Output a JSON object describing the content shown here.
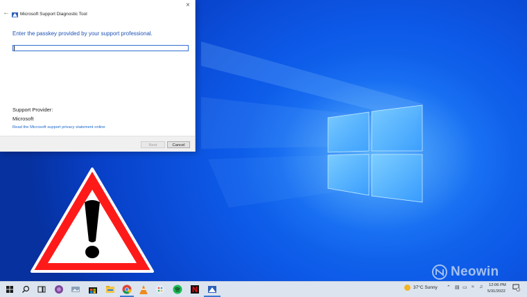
{
  "dialog": {
    "title": "Microsoft Support Diagnostic Tool",
    "prompt": "Enter the passkey provided by your support professional.",
    "passkey_value": "",
    "provider_label": "Support Provider:",
    "provider_name": "Microsoft",
    "privacy_link": "Read the Microsoft support privacy statement online",
    "next_label": "Next",
    "cancel_label": "Cancel"
  },
  "watermark": {
    "text": "Neowin"
  },
  "taskbar": {
    "icons": [
      "windows-start-icon",
      "search-icon",
      "task-view-icon",
      "tor-browser-icon",
      "photos-icon",
      "microsoft-store-icon",
      "file-explorer-icon",
      "chrome-icon",
      "vlc-icon",
      "paint-icon",
      "spotify-icon",
      "netflix-icon",
      "diagnostic-tool-icon"
    ],
    "weather": "37°C  Sunny",
    "time": "12:06 PM",
    "date": "5/31/2022",
    "notification_count": "1"
  },
  "colors": {
    "accent": "#1e52b5",
    "link": "#1a68c9",
    "warning_red": "#ff1a1a",
    "desktop_blue": "#0a4fd6"
  }
}
